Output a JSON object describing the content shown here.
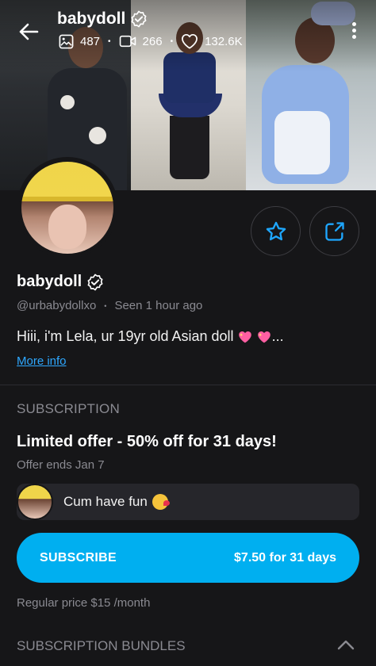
{
  "header": {
    "name": "babydoll",
    "stats": {
      "photos": "487",
      "videos": "266",
      "likes": "132.6K"
    }
  },
  "profile": {
    "name": "babydoll",
    "handle": "@urbabydollxo",
    "last_seen": "Seen 1 hour ago",
    "bio": "Hiii, i'm Lela, ur 19yr old Asian doll",
    "bio_suffix": "...",
    "more_info": "More info"
  },
  "subscription": {
    "heading": "SUBSCRIPTION",
    "offer_title": "Limited offer - 50% off for 31 days!",
    "offer_ends": "Offer ends Jan 7",
    "message": "Cum have fun",
    "subscribe_label": "SUBSCRIBE",
    "subscribe_price": "$7.50 for 31 days",
    "regular_price": "Regular price $15 /month"
  },
  "bundles": {
    "heading": "SUBSCRIPTION BUNDLES"
  },
  "icons": {
    "back": "arrow-left-icon",
    "verified": "verified-badge-icon",
    "photos": "image-icon",
    "videos": "video-icon",
    "likes": "heart-icon",
    "more": "more-vertical-icon",
    "favorite": "star-icon",
    "share": "share-icon",
    "collapse": "chevron-up-icon"
  },
  "colors": {
    "background": "#161618",
    "accent": "#00aff0",
    "link": "#2ea8ff",
    "muted_text": "#8a8a91",
    "card": "#26262b"
  }
}
